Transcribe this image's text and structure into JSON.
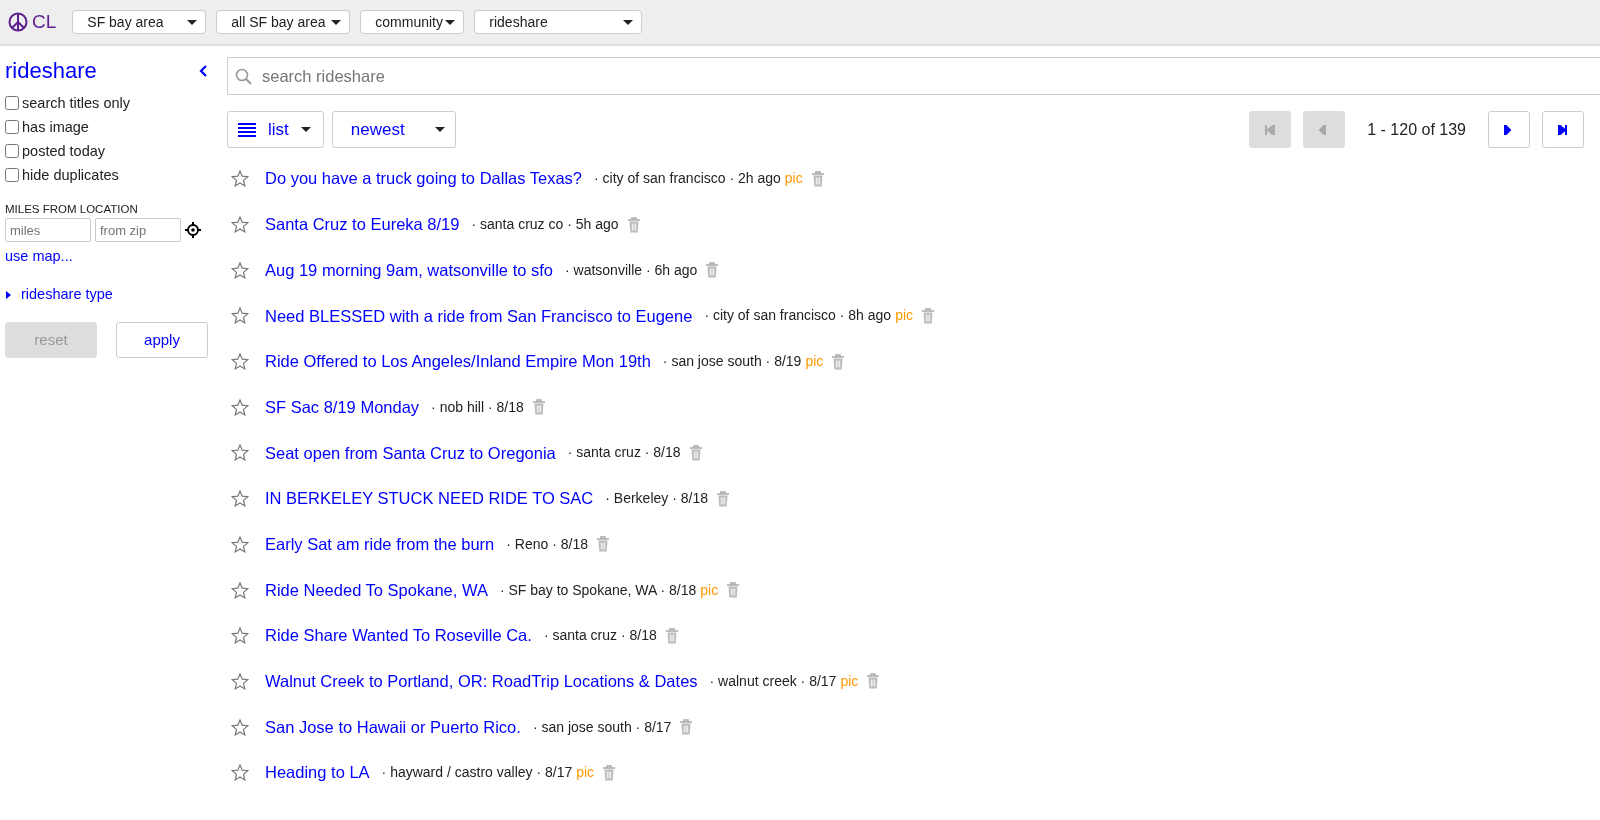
{
  "header": {
    "logo_text": "CL",
    "selectors": [
      {
        "value": "SF bay area"
      },
      {
        "value": "all SF bay area"
      },
      {
        "value": "community"
      },
      {
        "value": "rideshare"
      }
    ]
  },
  "sidebar": {
    "title": "rideshare",
    "filters": [
      {
        "label": "search titles only",
        "checked": false
      },
      {
        "label": "has image",
        "checked": false
      },
      {
        "label": "posted today",
        "checked": false
      },
      {
        "label": "hide duplicates",
        "checked": false
      }
    ],
    "miles_heading": "MILES FROM LOCATION",
    "miles_placeholder": "miles",
    "zip_placeholder": "from zip",
    "map_link": "use map...",
    "rideshare_type": {
      "label": "rideshare type",
      "expanded": false
    },
    "buttons": [
      {
        "label": "reset",
        "disabled": true
      },
      {
        "label": "apply",
        "disabled": false
      }
    ]
  },
  "search": {
    "placeholder": "search rideshare"
  },
  "toolbar": {
    "view": "list",
    "sort": "newest",
    "pager_text": "1 - 120 of 139",
    "pager": [
      {
        "kind": "first",
        "disabled": true
      },
      {
        "kind": "prev",
        "disabled": true
      },
      {
        "kind": "next",
        "disabled": false
      },
      {
        "kind": "last",
        "disabled": false
      }
    ]
  },
  "results": [
    {
      "title": "Do you have a truck going to Dallas Texas?",
      "meta": "· city of san francisco · 2h ago",
      "pic": "pic",
      "favorite": false
    },
    {
      "title": "Santa Cruz to Eureka 8/19",
      "meta": "· santa cruz co · 5h ago",
      "favorite": false
    },
    {
      "title": "Aug 19 morning 9am, watsonville to sfo",
      "meta": "· watsonville · 6h ago",
      "favorite": false
    },
    {
      "title": "Need BLESSED with a ride from San Francisco to Eugene",
      "meta": "· city of san francisco · 8h ago",
      "pic": "pic",
      "favorite": false
    },
    {
      "title": "Ride Offered to Los Angeles/Inland Empire Mon 19th",
      "meta": "· san jose south · 8/19",
      "pic": "pic",
      "favorite": false
    },
    {
      "title": "SF Sac 8/19 Monday",
      "meta": "· nob hill · 8/18",
      "favorite": false
    },
    {
      "title": "Seat open from Santa Cruz to Oregonia",
      "meta": "· santa cruz · 8/18",
      "favorite": false
    },
    {
      "title": "IN BERKELEY STUCK NEED RIDE TO SAC",
      "meta": "· Berkeley · 8/18",
      "favorite": false
    },
    {
      "title": "Early Sat am ride from the burn",
      "meta": "· Reno · 8/18",
      "favorite": false
    },
    {
      "title": "Ride Needed To Spokane, WA",
      "meta": "· SF bay to Spokane, WA · 8/18",
      "pic": "pic",
      "favorite": false
    },
    {
      "title": "Ride Share Wanted To Roseville Ca.",
      "meta": "· santa cruz · 8/18",
      "favorite": false
    },
    {
      "title": "Walnut Creek to Portland, OR: RoadTrip Locations & Dates",
      "meta": "· walnut creek · 8/17",
      "pic": "pic",
      "favorite": false
    },
    {
      "title": "San Jose to Hawaii or Puerto Rico.",
      "meta": "· san jose south · 8/17",
      "favorite": false
    },
    {
      "title": "Heading to LA",
      "meta": "· hayward / castro valley · 8/17",
      "pic": "pic",
      "favorite": false
    }
  ]
}
